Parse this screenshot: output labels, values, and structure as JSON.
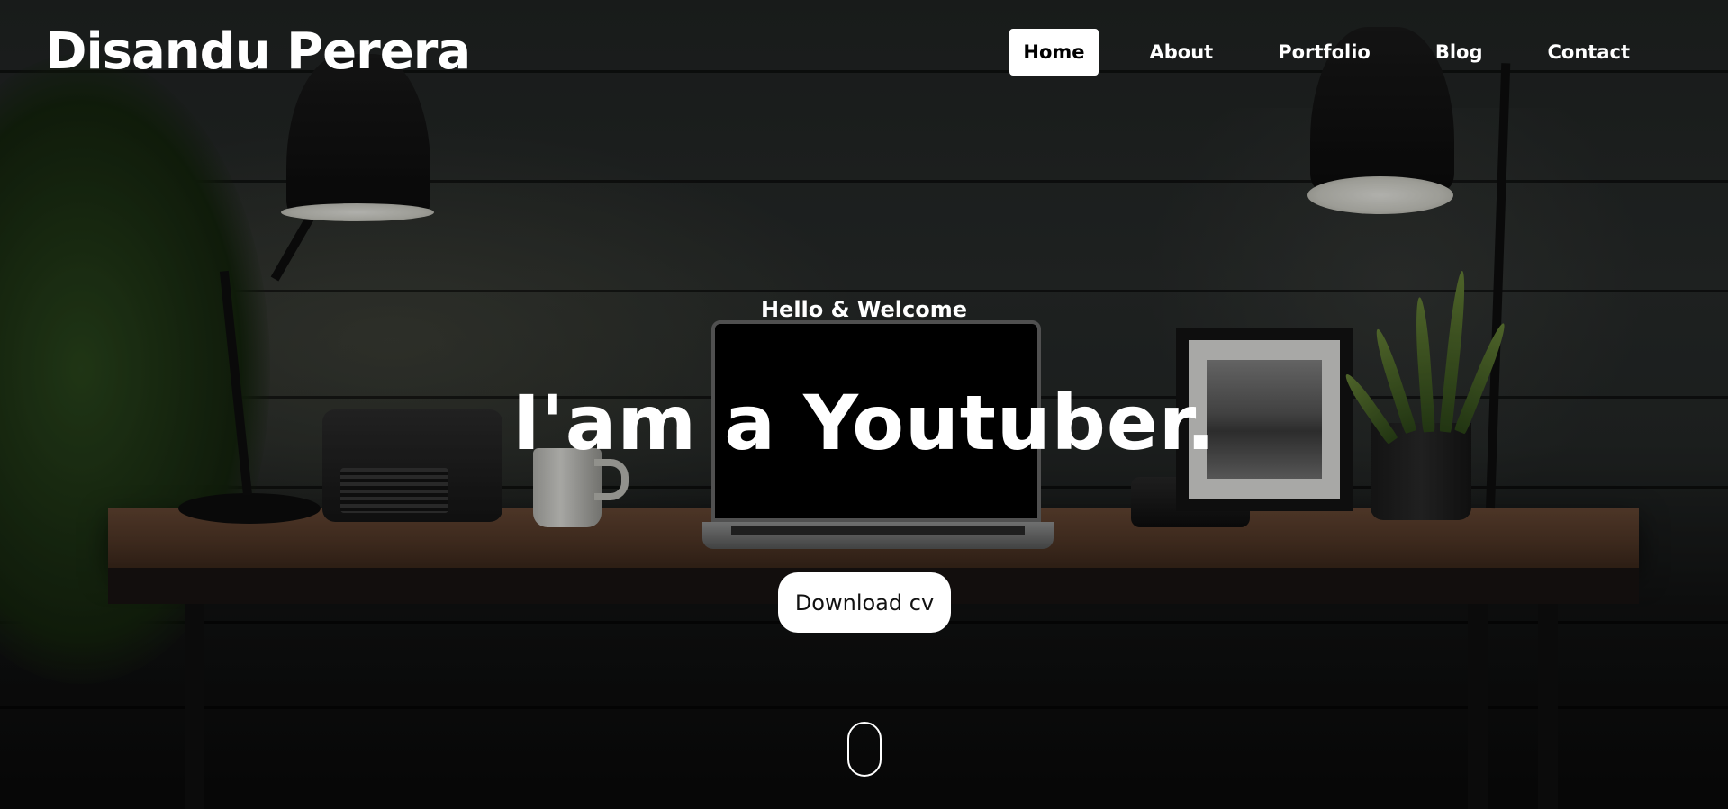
{
  "brand": {
    "name": "Disandu Perera"
  },
  "nav": {
    "items": [
      {
        "label": "Home",
        "active": true
      },
      {
        "label": "About",
        "active": false
      },
      {
        "label": "Portfolio",
        "active": false
      },
      {
        "label": "Blog",
        "active": false
      },
      {
        "label": "Contact",
        "active": false
      }
    ]
  },
  "hero": {
    "greeting": "Hello & Welcome",
    "headline": "I'am a Youtuber.",
    "cta_label": "Download cv",
    "scroll_icon": "mouse-scroll-icon"
  },
  "colors": {
    "text": "#ffffff",
    "active_nav_bg": "#ffffff",
    "active_nav_text": "#000000",
    "cta_bg": "#ffffff",
    "cta_text": "#111111"
  }
}
